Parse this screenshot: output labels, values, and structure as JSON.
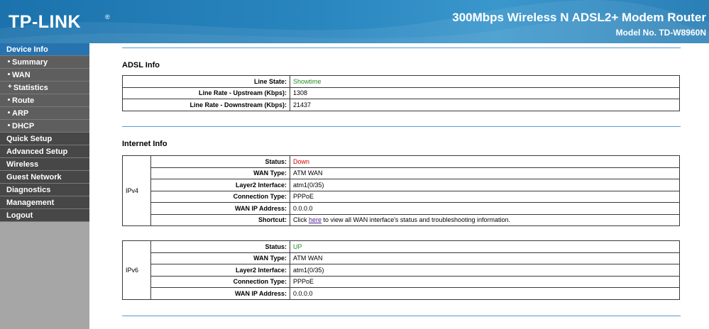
{
  "header": {
    "logo": "TP-LINK",
    "logo_mark": "®",
    "product": "300Mbps Wireless N ADSL2+ Modem Router",
    "model": "Model No. TD-W8960N"
  },
  "sidebar": {
    "items": [
      {
        "label": "Device Info",
        "level": "top",
        "active": true
      },
      {
        "label": "Summary",
        "level": "sub"
      },
      {
        "label": "WAN",
        "level": "sub"
      },
      {
        "label": "Statistics",
        "level": "sub",
        "expandable": true
      },
      {
        "label": "Route",
        "level": "sub"
      },
      {
        "label": "ARP",
        "level": "sub"
      },
      {
        "label": "DHCP",
        "level": "sub"
      },
      {
        "label": "Quick Setup",
        "level": "top"
      },
      {
        "label": "Advanced Setup",
        "level": "top"
      },
      {
        "label": "Wireless",
        "level": "top"
      },
      {
        "label": "Guest Network",
        "level": "top"
      },
      {
        "label": "Diagnostics",
        "level": "top"
      },
      {
        "label": "Management",
        "level": "top"
      },
      {
        "label": "Logout",
        "level": "top"
      }
    ]
  },
  "adsl": {
    "title": "ADSL Info",
    "rows": [
      {
        "label": "Line State:",
        "value": "Showtime"
      },
      {
        "label": "Line Rate - Upstream (Kbps):",
        "value": "1308"
      },
      {
        "label": "Line Rate - Downstream (Kbps):",
        "value": "21437"
      }
    ]
  },
  "internet": {
    "title": "Internet Info",
    "ipv4": {
      "group": "IPv4",
      "rows": [
        {
          "label": "Status:",
          "value": "Down"
        },
        {
          "label": "WAN Type:",
          "value": "ATM WAN"
        },
        {
          "label": "Layer2 Interface:",
          "value": "atm1(0/35)"
        },
        {
          "label": "Connection Type:",
          "value": "PPPoE"
        },
        {
          "label": "WAN IP Address:",
          "value": "0.0.0.0"
        }
      ],
      "shortcut": {
        "label": "Shortcut:",
        "prefix": "Click ",
        "link": "here",
        "suffix": " to view all WAN interface's status and troubleshooting information."
      }
    },
    "ipv6": {
      "group": "IPv6",
      "rows": [
        {
          "label": "Status:",
          "value": "UP"
        },
        {
          "label": "WAN Type:",
          "value": "ATM WAN"
        },
        {
          "label": "Layer2 Interface:",
          "value": "atm1(0/35)"
        },
        {
          "label": "Connection Type:",
          "value": "PPPoE"
        },
        {
          "label": "WAN IP Address:",
          "value": "0.0.0.0"
        }
      ]
    }
  },
  "colors": {
    "status_ok": "#228b22",
    "status_down": "#d40000",
    "accent": "#2773b0"
  }
}
